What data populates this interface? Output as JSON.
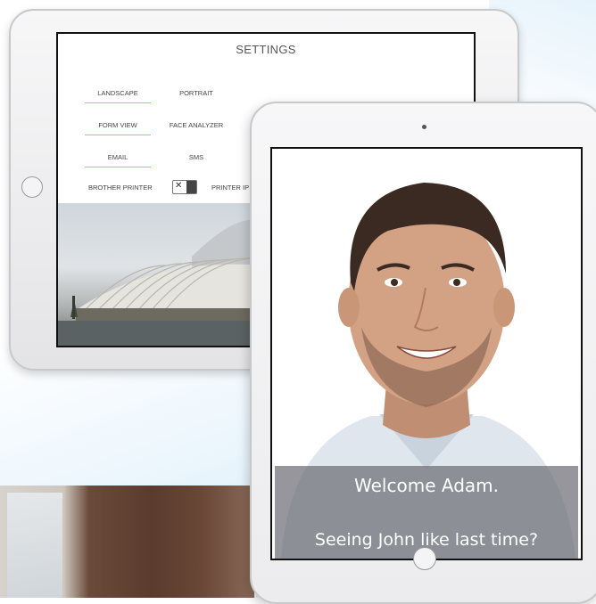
{
  "settings": {
    "title": "SETTINGS",
    "orientation": {
      "options": [
        "LANDSCAPE",
        "PORTRAIT"
      ],
      "selected": "LANDSCAPE"
    },
    "view": {
      "options": [
        "FORM VIEW",
        "FACE ANALYZER"
      ],
      "selected": "FORM VIEW"
    },
    "notify": {
      "options": [
        "EMAIL",
        "SMS"
      ],
      "selected": "EMAIL"
    },
    "printer": {
      "label": "BROTHER PRINTER",
      "toggle_symbol": "✕",
      "ip_label": "PRINTER IP"
    }
  },
  "kiosk": {
    "welcome": "Welcome Adam.",
    "question": "Seeing John like last time?"
  },
  "colors": {
    "selected_underline": "#8cc4e6",
    "overlay": "#6e6e76"
  },
  "icons": [
    "home-button-icon",
    "camera-icon",
    "toggle-x-icon"
  ]
}
